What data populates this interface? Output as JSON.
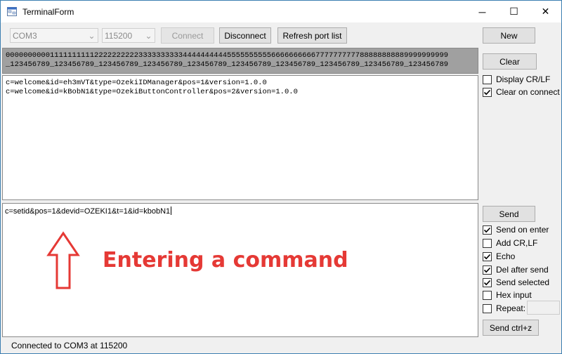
{
  "window": {
    "title": "TerminalForm",
    "minimize_glyph": "─",
    "maximize_glyph": "☐",
    "close_glyph": "✕"
  },
  "toolbar": {
    "port_value": "COM3",
    "baud_value": "115200",
    "connect_label": "Connect",
    "disconnect_label": "Disconnect",
    "refresh_label": "Refresh port list",
    "dropdown_glyph": "⌄"
  },
  "sidebar": {
    "new_label": "New",
    "clear_label": "Clear",
    "display_crlf": {
      "label": "Display CR/LF",
      "checked": false
    },
    "clear_on_connect": {
      "label": "Clear on connect",
      "checked": true
    },
    "send_label": "Send",
    "send_on_enter": {
      "label": "Send on enter",
      "checked": true
    },
    "add_crlf": {
      "label": "Add CR,LF",
      "checked": false
    },
    "echo": {
      "label": "Echo",
      "checked": true
    },
    "del_after_send": {
      "label": "Del after send",
      "checked": true
    },
    "send_selected": {
      "label": "Send selected",
      "checked": true
    },
    "hex_input": {
      "label": "Hex input",
      "checked": false
    },
    "repeat": {
      "label": "Repeat:",
      "checked": false
    },
    "send_ctrlz_label": "Send ctrl+z"
  },
  "ruler": {
    "line1": "0000000000111111111122222222223333333333444444444455555555556666666666777777777788888888889999999999",
    "line2": "_123456789_123456789_123456789_123456789_123456789_123456789_123456789_123456789_123456789_123456789"
  },
  "output": {
    "lines": [
      "c=welcome&id=eh3mVT&type=OzekiIDManager&pos=1&version=1.0.0",
      "c=welcome&id=kBobN1&type=OzekiButtonController&pos=2&version=1.0.0"
    ]
  },
  "input": {
    "value": "c=setid&pos=1&devid=OZEKI1&t=1&id=kbobN1"
  },
  "annotation": {
    "text": "Entering a command",
    "color": "#e53935"
  },
  "status": {
    "text": "Connected to COM3 at 115200"
  }
}
